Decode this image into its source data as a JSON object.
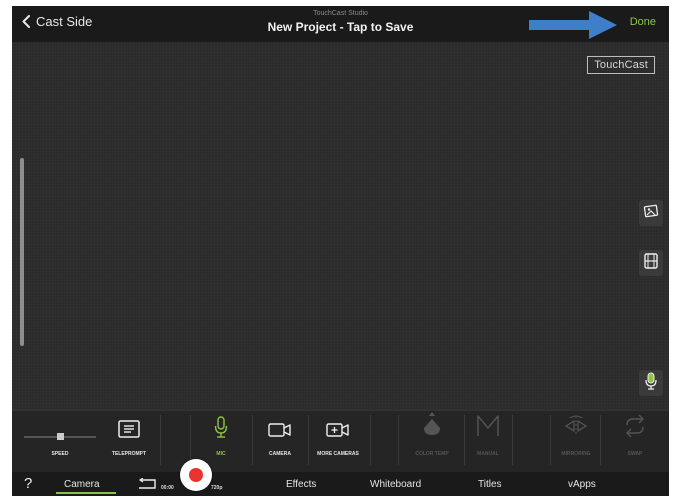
{
  "topbar": {
    "back_label": "Cast Side",
    "studio_label": "TouchCast Studio",
    "project_title": "New Project - Tap to Save",
    "done_label": "Done"
  },
  "canvas": {
    "logo_text": "TouchCast",
    "side_buttons": [
      "image-icon",
      "film-icon",
      "mic-icon"
    ]
  },
  "tools": {
    "speed": "SPEED",
    "teleprompt": "TELEPROMPT",
    "mic": "MIC",
    "camera": "CAMERA",
    "more_cameras": "MORE CAMERAS",
    "color_temp": "COLOR TEMP",
    "manual": "MANUAL",
    "mirroring": "MIRRORING",
    "swap": "SWAP"
  },
  "tabs": {
    "help": "?",
    "camera": "Camera",
    "time": "00:00",
    "resolution": "720p",
    "effects": "Effects",
    "whiteboard": "Whiteboard",
    "titles": "Titles",
    "vapps": "vApps"
  },
  "colors": {
    "accent": "#8cc63f",
    "record": "#e8342e",
    "arrow": "#3f7fc9"
  }
}
